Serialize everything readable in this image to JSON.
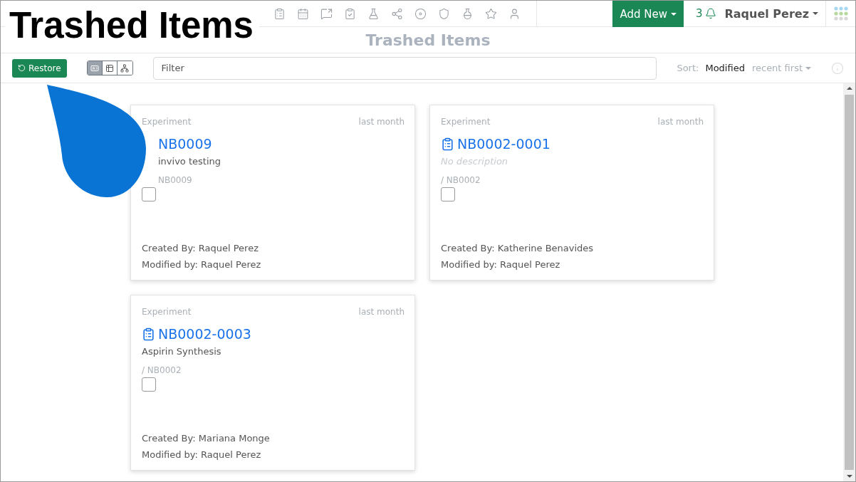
{
  "overlay_title": "Trashed Items",
  "topbar": {
    "add_new": "Add New",
    "notifications": "3",
    "user": "Raquel Perez"
  },
  "page_title": "Trashed Items",
  "toolbar": {
    "restore": "Restore",
    "view_modes": [
      {
        "selected": true
      },
      {
        "selected": false
      },
      {
        "selected": false
      }
    ],
    "filter": {
      "placeholder": "Filter"
    },
    "sort_label": "Sort:",
    "sort_field": "Modified",
    "sort_order": "recent first"
  },
  "cards": [
    {
      "type": "Experiment",
      "time": "last month",
      "title": "NB0009",
      "covered": true,
      "description": "invivo testing",
      "description_empty": false,
      "path": "NB0009",
      "checked": false,
      "created_by": "Created By: Raquel Perez",
      "modified_by": "Modified by: Raquel Perez"
    },
    {
      "type": "Experiment",
      "time": "last month",
      "title": "NB0002-0001",
      "covered": false,
      "description": "No description",
      "description_empty": true,
      "path": "/ NB0002",
      "checked": false,
      "created_by": "Created By: Katherine Benavides",
      "modified_by": "Modified by: Raquel Perez"
    },
    {
      "type": "Experiment",
      "time": "last month",
      "title": "NB0002-0003",
      "covered": false,
      "description": "Aspirin Synthesis",
      "description_empty": false,
      "path": "/ NB0002",
      "checked": false,
      "created_by": "Created By: Mariana Monge",
      "modified_by": "Modified by: Raquel Perez"
    }
  ]
}
